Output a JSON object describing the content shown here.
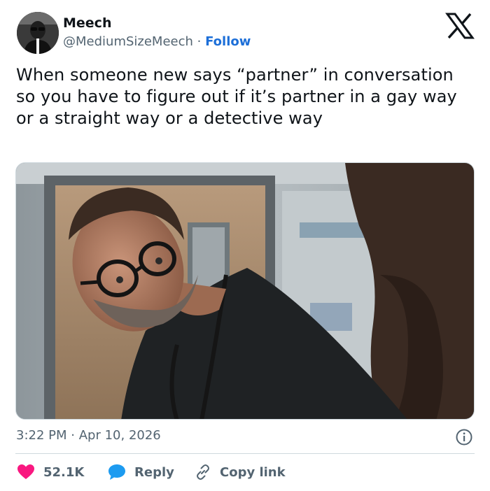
{
  "author": {
    "name": "Meech",
    "handle": "@MediumSizeMeech",
    "separator": "·",
    "follow_label": "Follow"
  },
  "tweet": {
    "text": "When someone new says “partner” in conversation so you have to figure out if it’s partner in a gay way or a straight way or a detective way",
    "time": "3:22 PM",
    "date_separator": "·",
    "date": "Apr 10, 2026"
  },
  "actions": {
    "likes": "52.1K",
    "reply_label": "Reply",
    "copy_label": "Copy link"
  },
  "icons": {
    "brand": "x-logo-icon",
    "info": "info-icon",
    "like": "heart-icon",
    "reply": "speech-bubble-icon",
    "copy": "link-icon"
  },
  "colors": {
    "text": "#0f1419",
    "secondary": "#536471",
    "link": "#1d6fd8",
    "like": "#f91880",
    "reply": "#1d9bf0"
  }
}
